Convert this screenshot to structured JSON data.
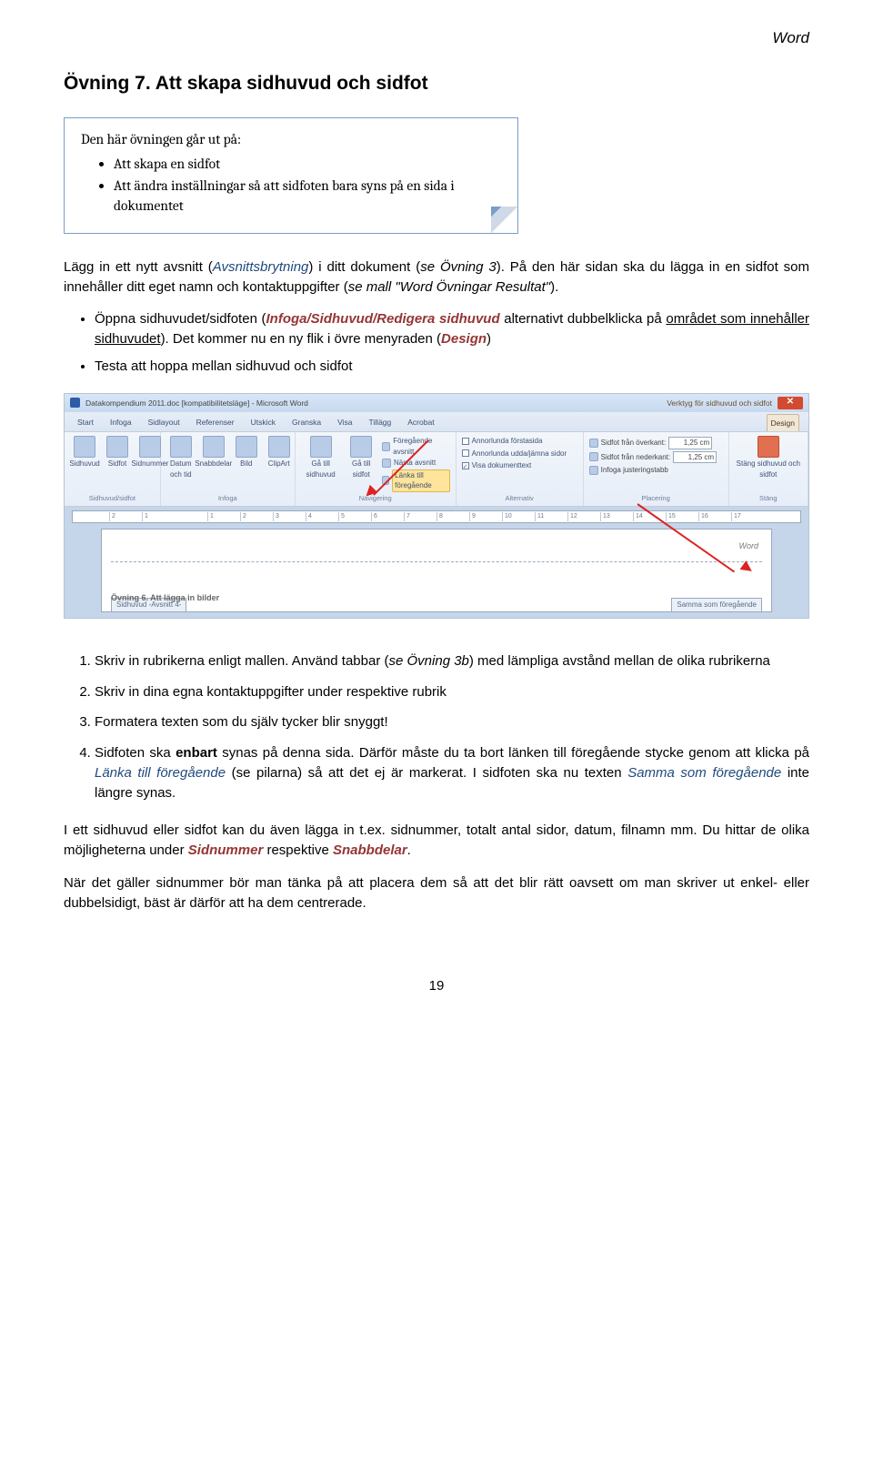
{
  "header_label": "Word",
  "h1": "Övning 7. Att skapa sidhuvud och sidfot",
  "callout": {
    "intro": "Den här övningen går ut på:",
    "b1": "Att skapa en sidfot",
    "b2": "Att ändra inställningar så att sidfoten bara syns på en sida i dokumentet"
  },
  "intro": {
    "pre": "Lägg in ett nytt avsnitt (",
    "avs": "Avsnittsbrytning",
    "mid": ") i ditt dokument (",
    "ov3": "se Övning 3",
    "post": "). På den här sidan ska du lägga in en sidfot som innehåller ditt eget namn och kontaktuppgifter (",
    "mall": "se mall \"Word Övningar Resultat\"",
    "end": ")."
  },
  "bul": {
    "a_pre": "Öppna sidhuvudet/sidfoten (",
    "a_cmd": "Infoga/Sidhuvud/Redigera sidhuvud",
    "a_post": " alternativt dubbelklicka på ",
    "a_under": "området som innehåller sidhuvudet",
    "a_end": "). Det kommer nu en ny flik i övre menyraden (",
    "a_design": "Design",
    "a_close": ")",
    "b": "Testa att hoppa mellan sidhuvud och sidfot"
  },
  "shot": {
    "title": "Datakompendium 2011.doc [kompatibilitetsläge] - Microsoft Word",
    "tooltitle": "Verktyg för sidhuvud och sidfot",
    "tabs": [
      "Start",
      "Infoga",
      "Sidlayout",
      "Referenser",
      "Utskick",
      "Granska",
      "Visa",
      "Tillägg",
      "Acrobat"
    ],
    "tab_sel": "Design",
    "grp1_lbl": "Sidhuvud/sidfot",
    "grp1_items": [
      "Sidhuvud",
      "Sidfot",
      "Sidnummer"
    ],
    "grp2_lbl": "Infoga",
    "grp2_items": [
      "Datum och tid",
      "Snabbdelar",
      "Bild",
      "ClipArt"
    ],
    "grp3_lbl": "Navigering",
    "grp3_items": [
      "Gå till sidhuvud",
      "Gå till sidfot"
    ],
    "nav_a": "Föregående avsnitt",
    "nav_b": "Nästa avsnitt",
    "nav_c": "Länka till föregående",
    "grp4_lbl": "Alternativ",
    "opt_a": "Annorlunda förstasida",
    "opt_b": "Annorlunda udda/jämna sidor",
    "opt_c": "Visa dokumenttext",
    "grp5_lbl": "Placering",
    "pl_a": "Sidfot från överkant:",
    "pl_av": "1,25 cm",
    "pl_b": "Sidfot från nederkant:",
    "pl_bv": "1,25 cm",
    "pl_c": "Infoga justeringstabb",
    "grp6_lbl": "Stäng",
    "grp6_item": "Stäng sidhuvud och sidfot",
    "corner_word": "Word",
    "hdrtab_left": "Sidhuvud -Avsnitt 4-",
    "body_peek": "Övning 6. Att lägga in bilder",
    "hdrtab_right": "Samma som föregående"
  },
  "steps": {
    "s1a": "Skriv in rubrikerna enligt mallen. Använd tabbar (",
    "s1b": "se Övning 3b",
    "s1c": ") med lämpliga avstånd mellan de olika rubrikerna",
    "s2": "Skriv in dina egna kontaktuppgifter under respektive rubrik",
    "s3": "Formatera texten som du själv tycker blir snyggt!",
    "s4a": "Sidfoten ska ",
    "s4b": "enbart",
    "s4c": " synas på denna sida. Därför måste du ta bort länken till föregående stycke genom att klicka på ",
    "s4d": "Länka till föregående",
    "s4e": " (se pilarna) så att det ej är markerat. I sidfoten ska nu texten ",
    "s4f": "Samma som föregående",
    "s4g": " inte längre synas."
  },
  "p2": {
    "a": "I ett sidhuvud eller sidfot kan du även lägga in t.ex. sidnummer, totalt antal sidor, datum, filnamn mm. Du hittar de olika möjligheterna under ",
    "b": "Sidnummer",
    "c": " respektive ",
    "d": "Snabbdelar",
    "e": "."
  },
  "p3": "När det gäller sidnummer bör man tänka på att placera dem så att det blir rätt oavsett om man skriver ut enkel- eller dubbelsidigt, bäst är därför att ha dem centrerade.",
  "pagenum": "19"
}
